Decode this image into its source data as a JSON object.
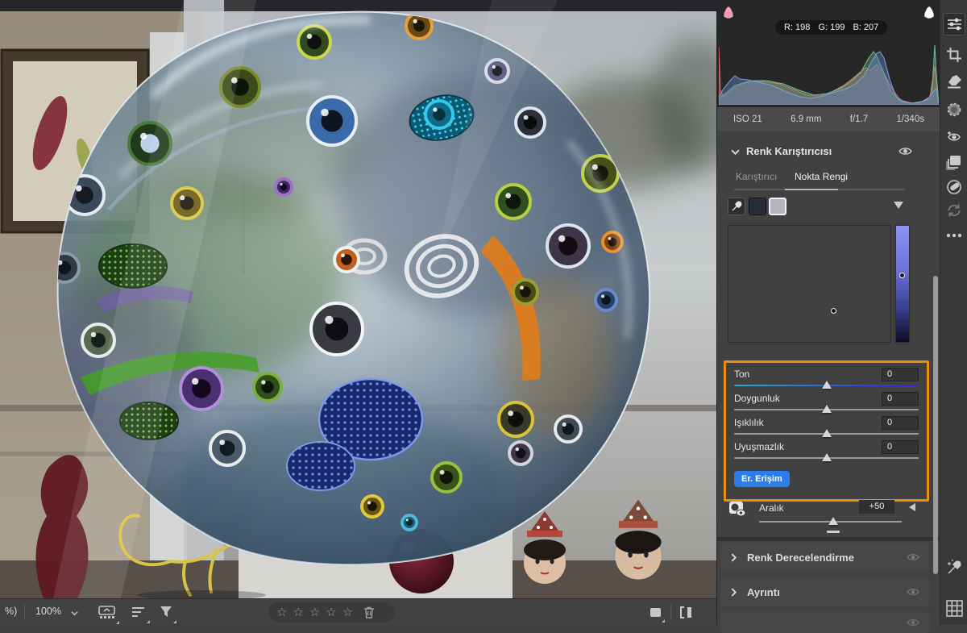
{
  "histogram": {
    "rgb": {
      "r": "R: 198",
      "g": "G: 199",
      "b": "B: 207"
    },
    "exif": {
      "iso": "ISO 21",
      "focal_length": "6.9 mm",
      "aperture": "f/1.7",
      "shutter": "1/340s"
    }
  },
  "color_mixer": {
    "title": "Renk Karıştırıcısı",
    "tab_mixer": "Karıştırıcı",
    "tab_point_color": "Nokta Rengi",
    "sliders": [
      {
        "label": "Ton",
        "value": "0"
      },
      {
        "label": "Doygunluk",
        "value": "0"
      },
      {
        "label": "Işıklılık",
        "value": "0"
      },
      {
        "label": "Uyuşmazlık",
        "value": "0"
      }
    ],
    "early_access": "Er. Erişim",
    "range_label": "Aralık",
    "range_value": "+50"
  },
  "sections": {
    "color_grading": "Renk Derecelendirme",
    "detail": "Ayrıntı"
  },
  "bottom_bar": {
    "zoom_fragment": "%)",
    "zoom_level": "100%"
  },
  "colors": {
    "highlight_orange": "#ec8f0a",
    "button_blue": "#2b7de9"
  }
}
